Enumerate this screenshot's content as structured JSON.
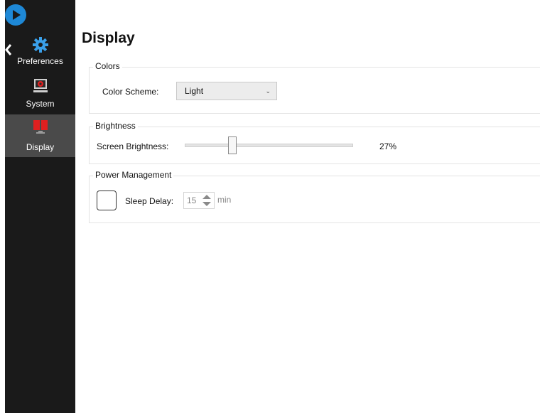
{
  "sidebar": {
    "items": [
      {
        "label": "Preferences",
        "icon": "gear-icon",
        "selected": false
      },
      {
        "label": "System",
        "icon": "system-icon",
        "selected": false
      },
      {
        "label": "Display",
        "icon": "display-icon",
        "selected": true
      }
    ]
  },
  "page": {
    "title": "Display"
  },
  "colors": {
    "legend": "Colors",
    "color_scheme_label": "Color Scheme:",
    "color_scheme_value": "Light"
  },
  "brightness": {
    "legend": "Brightness",
    "label": "Screen Brightness:",
    "value_text": "27%",
    "value": 27
  },
  "power": {
    "legend": "Power Management",
    "sleep_checked": false,
    "sleep_label": "Sleep Delay:",
    "sleep_value": "15",
    "unit": "min"
  },
  "theme": {
    "sidebar_bg": "#1a1a1a",
    "selected_bg": "#4a4a4a",
    "accent": "#1e88d6",
    "icon_red": "#e02020"
  }
}
